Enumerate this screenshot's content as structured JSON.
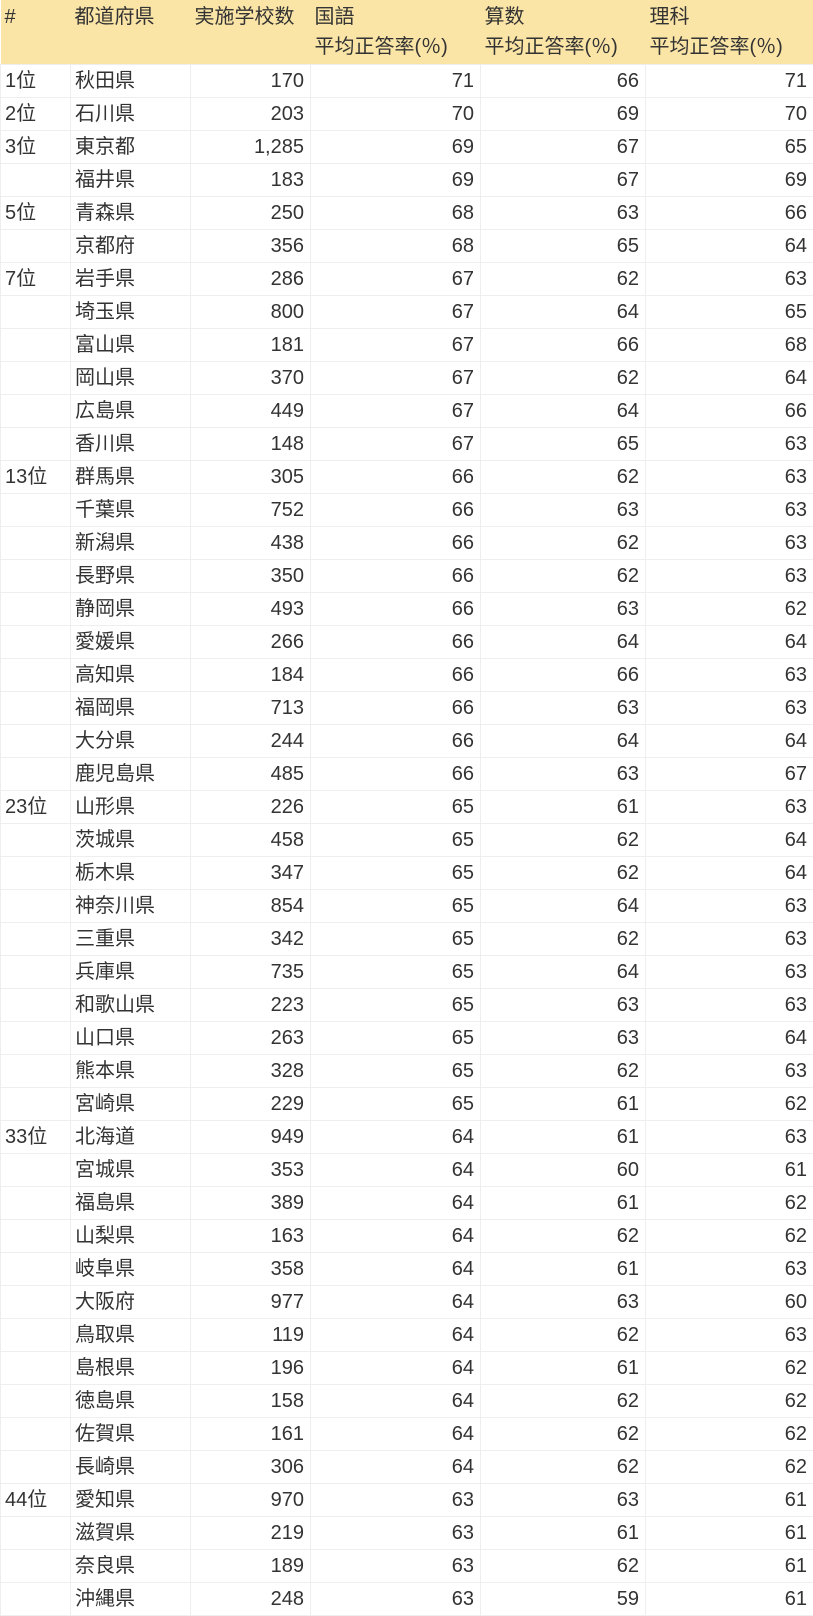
{
  "headers": {
    "rank": "#",
    "pref": "都道府県",
    "schools": "実施学校数",
    "kokugo_line1": "国語",
    "kokugo_line2": "平均正答率(％)",
    "sansuu_line1": "算数",
    "sansuu_line2": "平均正答率(％)",
    "rika_line1": "理科",
    "rika_line2": "平均正答率(％)"
  },
  "rows": [
    {
      "rank": "1位",
      "pref": "秋田県",
      "schools": "170",
      "kokugo": "71",
      "sansuu": "66",
      "rika": "71"
    },
    {
      "rank": "2位",
      "pref": "石川県",
      "schools": "203",
      "kokugo": "70",
      "sansuu": "69",
      "rika": "70"
    },
    {
      "rank": "3位",
      "pref": "東京都",
      "schools": "1,285",
      "kokugo": "69",
      "sansuu": "67",
      "rika": "65"
    },
    {
      "rank": "",
      "pref": "福井県",
      "schools": "183",
      "kokugo": "69",
      "sansuu": "67",
      "rika": "69"
    },
    {
      "rank": "5位",
      "pref": "青森県",
      "schools": "250",
      "kokugo": "68",
      "sansuu": "63",
      "rika": "66"
    },
    {
      "rank": "",
      "pref": "京都府",
      "schools": "356",
      "kokugo": "68",
      "sansuu": "65",
      "rika": "64"
    },
    {
      "rank": "7位",
      "pref": "岩手県",
      "schools": "286",
      "kokugo": "67",
      "sansuu": "62",
      "rika": "63"
    },
    {
      "rank": "",
      "pref": "埼玉県",
      "schools": "800",
      "kokugo": "67",
      "sansuu": "64",
      "rika": "65"
    },
    {
      "rank": "",
      "pref": "富山県",
      "schools": "181",
      "kokugo": "67",
      "sansuu": "66",
      "rika": "68"
    },
    {
      "rank": "",
      "pref": "岡山県",
      "schools": "370",
      "kokugo": "67",
      "sansuu": "62",
      "rika": "64"
    },
    {
      "rank": "",
      "pref": "広島県",
      "schools": "449",
      "kokugo": "67",
      "sansuu": "64",
      "rika": "66"
    },
    {
      "rank": "",
      "pref": "香川県",
      "schools": "148",
      "kokugo": "67",
      "sansuu": "65",
      "rika": "63"
    },
    {
      "rank": "13位",
      "pref": "群馬県",
      "schools": "305",
      "kokugo": "66",
      "sansuu": "62",
      "rika": "63"
    },
    {
      "rank": "",
      "pref": "千葉県",
      "schools": "752",
      "kokugo": "66",
      "sansuu": "63",
      "rika": "63"
    },
    {
      "rank": "",
      "pref": "新潟県",
      "schools": "438",
      "kokugo": "66",
      "sansuu": "62",
      "rika": "63"
    },
    {
      "rank": "",
      "pref": "長野県",
      "schools": "350",
      "kokugo": "66",
      "sansuu": "62",
      "rika": "63"
    },
    {
      "rank": "",
      "pref": "静岡県",
      "schools": "493",
      "kokugo": "66",
      "sansuu": "63",
      "rika": "62"
    },
    {
      "rank": "",
      "pref": "愛媛県",
      "schools": "266",
      "kokugo": "66",
      "sansuu": "64",
      "rika": "64"
    },
    {
      "rank": "",
      "pref": "高知県",
      "schools": "184",
      "kokugo": "66",
      "sansuu": "66",
      "rika": "63"
    },
    {
      "rank": "",
      "pref": "福岡県",
      "schools": "713",
      "kokugo": "66",
      "sansuu": "63",
      "rika": "63"
    },
    {
      "rank": "",
      "pref": "大分県",
      "schools": "244",
      "kokugo": "66",
      "sansuu": "64",
      "rika": "64"
    },
    {
      "rank": "",
      "pref": "鹿児島県",
      "schools": "485",
      "kokugo": "66",
      "sansuu": "63",
      "rika": "67"
    },
    {
      "rank": "23位",
      "pref": "山形県",
      "schools": "226",
      "kokugo": "65",
      "sansuu": "61",
      "rika": "63"
    },
    {
      "rank": "",
      "pref": "茨城県",
      "schools": "458",
      "kokugo": "65",
      "sansuu": "62",
      "rika": "64"
    },
    {
      "rank": "",
      "pref": "栃木県",
      "schools": "347",
      "kokugo": "65",
      "sansuu": "62",
      "rika": "64"
    },
    {
      "rank": "",
      "pref": "神奈川県",
      "schools": "854",
      "kokugo": "65",
      "sansuu": "64",
      "rika": "63"
    },
    {
      "rank": "",
      "pref": "三重県",
      "schools": "342",
      "kokugo": "65",
      "sansuu": "62",
      "rika": "63"
    },
    {
      "rank": "",
      "pref": "兵庫県",
      "schools": "735",
      "kokugo": "65",
      "sansuu": "64",
      "rika": "63"
    },
    {
      "rank": "",
      "pref": "和歌山県",
      "schools": "223",
      "kokugo": "65",
      "sansuu": "63",
      "rika": "63"
    },
    {
      "rank": "",
      "pref": "山口県",
      "schools": "263",
      "kokugo": "65",
      "sansuu": "63",
      "rika": "64"
    },
    {
      "rank": "",
      "pref": "熊本県",
      "schools": "328",
      "kokugo": "65",
      "sansuu": "62",
      "rika": "63"
    },
    {
      "rank": "",
      "pref": "宮崎県",
      "schools": "229",
      "kokugo": "65",
      "sansuu": "61",
      "rika": "62"
    },
    {
      "rank": "33位",
      "pref": "北海道",
      "schools": "949",
      "kokugo": "64",
      "sansuu": "61",
      "rika": "63"
    },
    {
      "rank": "",
      "pref": "宮城県",
      "schools": "353",
      "kokugo": "64",
      "sansuu": "60",
      "rika": "61"
    },
    {
      "rank": "",
      "pref": "福島県",
      "schools": "389",
      "kokugo": "64",
      "sansuu": "61",
      "rika": "62"
    },
    {
      "rank": "",
      "pref": "山梨県",
      "schools": "163",
      "kokugo": "64",
      "sansuu": "62",
      "rika": "62"
    },
    {
      "rank": "",
      "pref": "岐阜県",
      "schools": "358",
      "kokugo": "64",
      "sansuu": "61",
      "rika": "63"
    },
    {
      "rank": "",
      "pref": "大阪府",
      "schools": "977",
      "kokugo": "64",
      "sansuu": "63",
      "rika": "60"
    },
    {
      "rank": "",
      "pref": "鳥取県",
      "schools": "119",
      "kokugo": "64",
      "sansuu": "62",
      "rika": "63"
    },
    {
      "rank": "",
      "pref": "島根県",
      "schools": "196",
      "kokugo": "64",
      "sansuu": "61",
      "rika": "62"
    },
    {
      "rank": "",
      "pref": "徳島県",
      "schools": "158",
      "kokugo": "64",
      "sansuu": "62",
      "rika": "62"
    },
    {
      "rank": "",
      "pref": "佐賀県",
      "schools": "161",
      "kokugo": "64",
      "sansuu": "62",
      "rika": "62"
    },
    {
      "rank": "",
      "pref": "長崎県",
      "schools": "306",
      "kokugo": "64",
      "sansuu": "62",
      "rika": "62"
    },
    {
      "rank": "44位",
      "pref": "愛知県",
      "schools": "970",
      "kokugo": "63",
      "sansuu": "63",
      "rika": "61"
    },
    {
      "rank": "",
      "pref": "滋賀県",
      "schools": "219",
      "kokugo": "63",
      "sansuu": "61",
      "rika": "61"
    },
    {
      "rank": "",
      "pref": "奈良県",
      "schools": "189",
      "kokugo": "63",
      "sansuu": "62",
      "rika": "61"
    },
    {
      "rank": "",
      "pref": "沖縄県",
      "schools": "248",
      "kokugo": "63",
      "sansuu": "59",
      "rika": "61"
    }
  ]
}
